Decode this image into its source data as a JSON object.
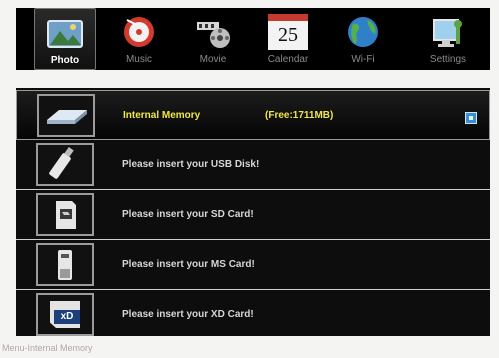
{
  "tabs": [
    {
      "label": "Photo",
      "icon": "photo-icon",
      "active": true
    },
    {
      "label": "Music",
      "icon": "music-disc-icon",
      "active": false
    },
    {
      "label": "Movie",
      "icon": "film-reel-icon",
      "active": false
    },
    {
      "label": "Calendar",
      "icon": "calendar-icon",
      "active": false,
      "day": "25"
    },
    {
      "label": "Wi-Fi",
      "icon": "globe-icon",
      "active": false
    },
    {
      "label": "Settings",
      "icon": "settings-monitor-icon",
      "active": false
    }
  ],
  "devices": [
    {
      "label": "Internal Memory",
      "free": "(Free:1711MB)",
      "icon": "internal-memory-icon",
      "selected": true
    },
    {
      "label": "Please insert your USB Disk!",
      "icon": "usb-disk-icon",
      "selected": false
    },
    {
      "label": "Please insert your SD Card!",
      "icon": "sd-card-icon",
      "selected": false
    },
    {
      "label": "Please insert your MS Card!",
      "icon": "ms-card-icon",
      "selected": false
    },
    {
      "label": "Please insert your XD Card!",
      "icon": "xd-card-icon",
      "xd_text": "xD",
      "selected": false
    }
  ],
  "status": {
    "text": "Menu-Internal Memory"
  },
  "colors": {
    "selected_text": "#f1e64a",
    "select_button": "#3a8fd3",
    "list_background": "#0d0d0d"
  }
}
